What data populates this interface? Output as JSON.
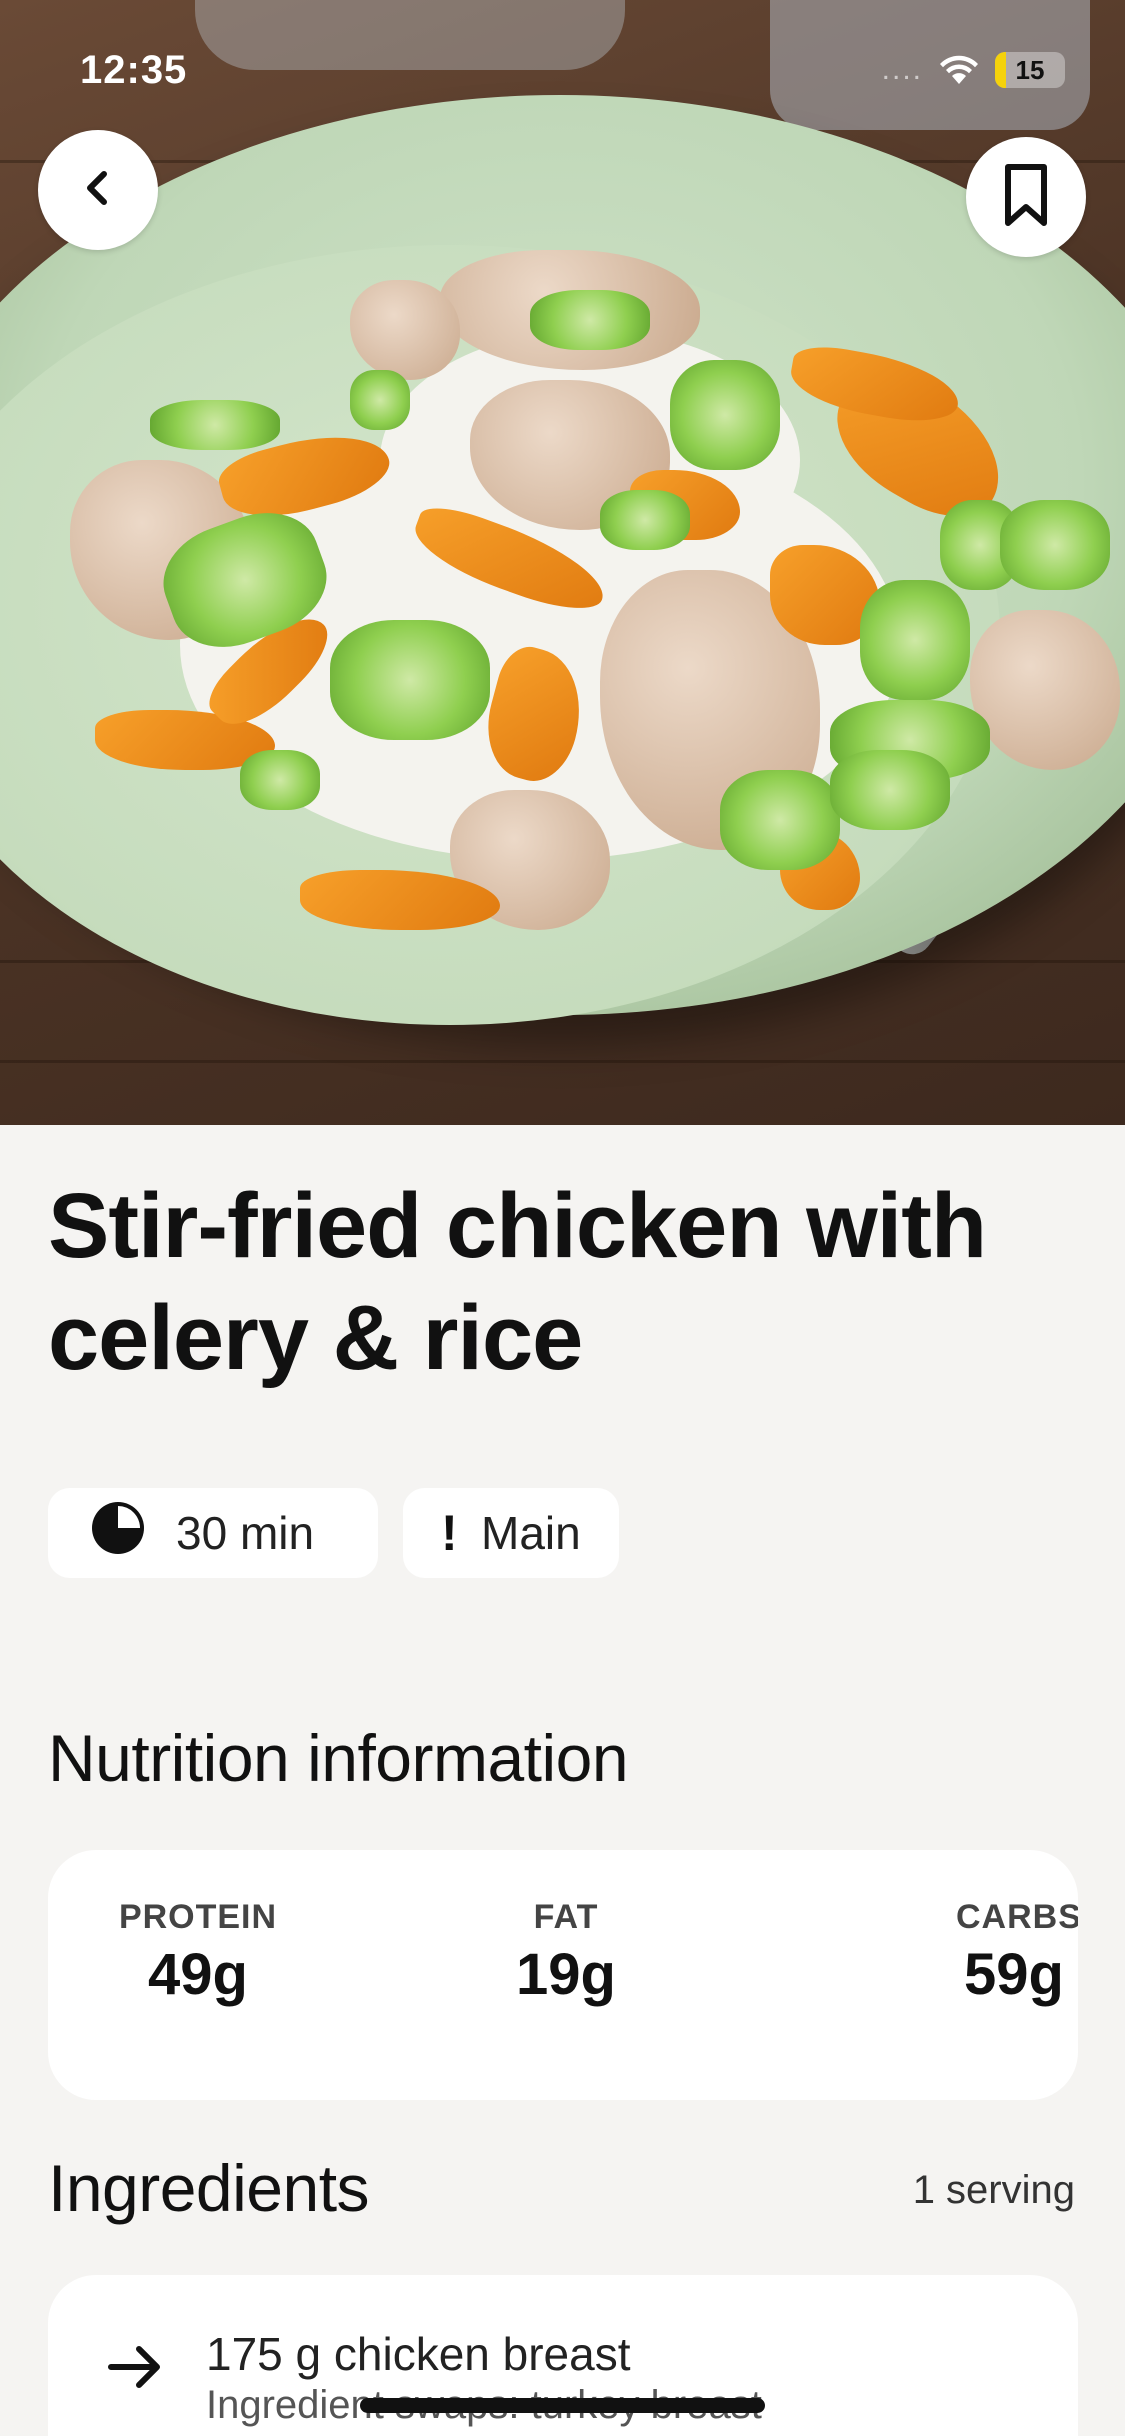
{
  "status_bar": {
    "time": "12:35",
    "battery_level": 15,
    "battery_label": "15",
    "battery_color": "#f5d20b",
    "icons": [
      "signal-dots",
      "wifi-icon",
      "battery-icon"
    ]
  },
  "hero": {
    "image_description": "Stir-fried chicken with celery, orange pepper and rice on a pale green plate",
    "back_icon": "chevron-left-icon",
    "bookmark_icon": "bookmark-icon"
  },
  "recipe": {
    "title": "Stir-fried chicken with celery & rice",
    "chips": [
      {
        "icon": "clock-icon",
        "label": "30 min"
      },
      {
        "icon": "exclamation-icon",
        "label": "Main"
      }
    ]
  },
  "nutrition": {
    "title": "Nutrition information",
    "items": [
      {
        "label": "PROTEIN",
        "value": "49g"
      },
      {
        "label": "FAT",
        "value": "19g"
      },
      {
        "label": "CARBS",
        "value": "59g"
      }
    ]
  },
  "ingredients": {
    "title": "Ingredients",
    "serving": "1 serving",
    "items": [
      {
        "icon": "arrow-right-icon",
        "name": "175 g chicken breast",
        "swap": "Ingredient swaps: turkey breast"
      }
    ]
  },
  "colors": {
    "background": "#f5f4f2",
    "card": "#ffffff",
    "text": "#111111"
  }
}
